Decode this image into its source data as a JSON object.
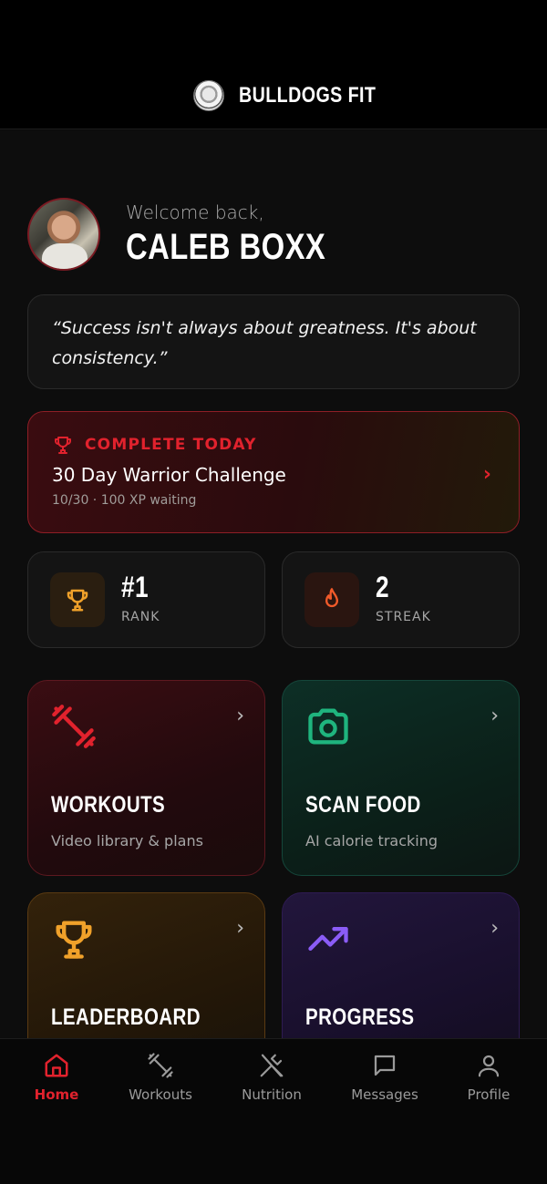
{
  "header": {
    "brand": "BULLDOGS FIT"
  },
  "welcome": {
    "label": "Welcome back,",
    "name": "CALEB BOXX"
  },
  "quote": {
    "text": "“Success isn't always about greatness. It's about consistency.”"
  },
  "challenge": {
    "label": "COMPLETE TODAY",
    "title": "30 Day Warrior Challenge",
    "subtitle": "10/30 · 100 XP waiting"
  },
  "stats": [
    {
      "value": "#1",
      "label": "RANK",
      "icon": "trophy-icon"
    },
    {
      "value": "2",
      "label": "STREAK",
      "icon": "flame-icon"
    }
  ],
  "tiles": [
    {
      "title": "WORKOUTS",
      "subtitle": "Video library & plans",
      "icon": "dumbbell-icon",
      "color": "#e1222d"
    },
    {
      "title": "SCAN FOOD",
      "subtitle": "AI calorie tracking",
      "icon": "camera-icon",
      "color": "#1fb47e"
    },
    {
      "title": "LEADERBOARD",
      "subtitle": "",
      "icon": "trophy-icon",
      "color": "#f0a12a"
    },
    {
      "title": "PROGRESS",
      "subtitle": "",
      "icon": "trending-up-icon",
      "color": "#8b5cf6"
    }
  ],
  "nav": [
    {
      "label": "Home",
      "icon": "home-icon",
      "active": true
    },
    {
      "label": "Workouts",
      "icon": "dumbbell-icon",
      "active": false
    },
    {
      "label": "Nutrition",
      "icon": "utensils-icon",
      "active": false
    },
    {
      "label": "Messages",
      "icon": "message-icon",
      "active": false
    },
    {
      "label": "Profile",
      "icon": "user-icon",
      "active": false
    }
  ],
  "colors": {
    "accent": "#e1222d",
    "background": "#0d0d0d"
  }
}
